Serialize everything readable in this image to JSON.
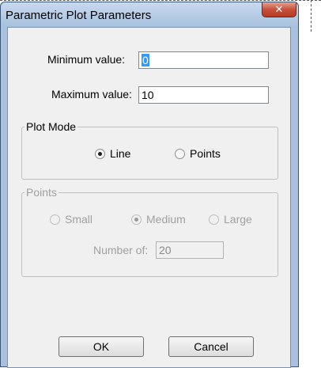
{
  "window": {
    "title": "Parametric Plot Parameters",
    "close_icon": "close-icon"
  },
  "fields": {
    "min_label": "Minimum value:",
    "min_value": "0",
    "max_label": "Maximum value:",
    "max_value": "10"
  },
  "plot_mode": {
    "legend": "Plot Mode",
    "options": [
      {
        "label": "Line",
        "checked": true
      },
      {
        "label": "Points",
        "checked": false
      }
    ]
  },
  "points": {
    "legend": "Points",
    "disabled": true,
    "options": [
      {
        "label": "Small",
        "checked": false
      },
      {
        "label": "Medium",
        "checked": true
      },
      {
        "label": "Large",
        "checked": false
      }
    ],
    "number_label": "Number of:",
    "number_value": "20"
  },
  "buttons": {
    "ok": "OK",
    "cancel": "Cancel"
  }
}
